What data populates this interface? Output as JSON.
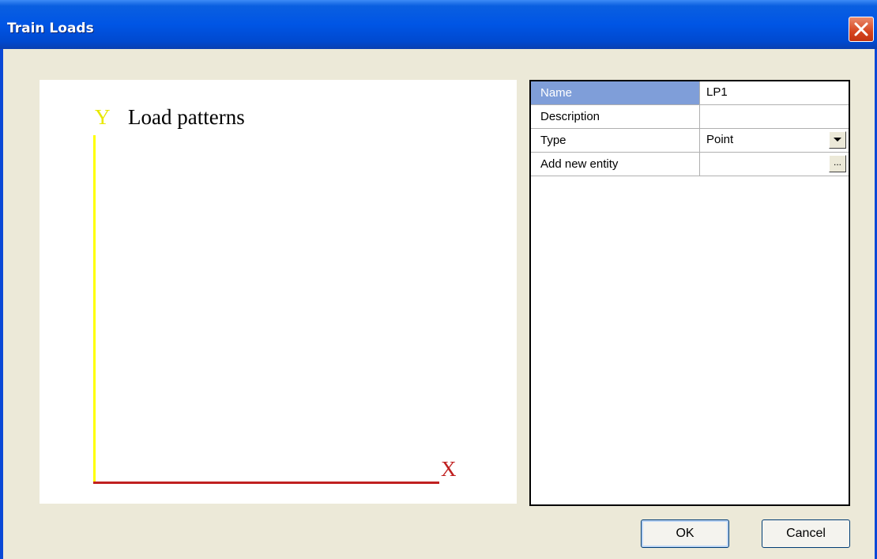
{
  "window": {
    "title": "Train Loads"
  },
  "canvas": {
    "title": "Load patterns",
    "y_axis_label": "Y",
    "x_axis_label": "X"
  },
  "properties": [
    {
      "name": "Name",
      "value": "LP1",
      "selected": true
    },
    {
      "name": "Description",
      "value": ""
    },
    {
      "name": "Type",
      "value": "Point",
      "control": "dropdown"
    },
    {
      "name": "Add new entity",
      "value": "",
      "control": "ellipsis",
      "button_label": "..."
    }
  ],
  "buttons": {
    "ok": "OK",
    "cancel": "Cancel"
  }
}
